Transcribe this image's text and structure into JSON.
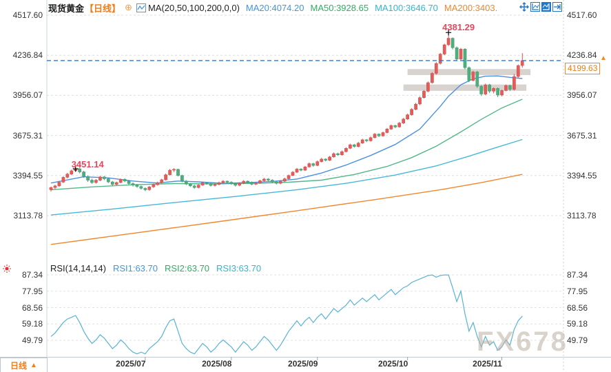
{
  "header": {
    "symbol": "现货黄金",
    "timeframe_tag": "【日线】",
    "add_icon": "⊕",
    "ma_label": "MA(20,50,100,200,0,0)",
    "ma_values": [
      {
        "label": "MA20:4074.20",
        "color": "#3f95e8"
      },
      {
        "label": "MA50:3928.65",
        "color": "#2fae62"
      },
      {
        "label": "MA100:3646.70",
        "color": "#2fb7d2"
      },
      {
        "label": "MA200:3403.",
        "color": "#f2862b"
      }
    ]
  },
  "toolbar": {
    "icons": [
      {
        "name": "pan-icon",
        "active": false
      },
      {
        "name": "left-axis-scale-icon",
        "active": false
      },
      {
        "name": "right-axis-scale-icon",
        "active": true
      },
      {
        "name": "shift-right-icon",
        "active": false
      }
    ],
    "accent_color": "#2176c7"
  },
  "rsi_header": {
    "name": "RSI(14,14,14)",
    "values": [
      {
        "label": "RSI1:63.70",
        "color": "#3f95e8"
      },
      {
        "label": "RSI2:63.70",
        "color": "#2fae62"
      },
      {
        "label": "RSI3:63.70",
        "color": "#2fb7d2"
      }
    ]
  },
  "footer": {
    "timeframe": "日线",
    "arrow": "▲"
  },
  "watermark": "FX678",
  "chart_data": [
    {
      "type": "candlestick",
      "title": "现货黄金 日线",
      "up_color": "#e15d5a",
      "down_color": "#4fae7d",
      "last_price": 4199.63,
      "last_price_line_color": "#1e78e8",
      "y_ticks": [
        4517.6,
        4236.84,
        3956.07,
        3675.31,
        3394.55,
        3113.78
      ],
      "x_labels": [
        {
          "label": "2025/07",
          "index": 23
        },
        {
          "label": "2025/08",
          "index": 44
        },
        {
          "label": "2025/09",
          "index": 65
        },
        {
          "label": "2025/10",
          "index": 87
        },
        {
          "label": "2025/11",
          "index": 110
        }
      ],
      "annotations": {
        "peak": {
          "index": 97,
          "price": 4381.29,
          "label": "4381.29"
        },
        "early_peak": {
          "index": 6,
          "price": 3451.14,
          "label": "3451.14"
        }
      },
      "zones": [
        {
          "i1": 87,
          "i2": 117,
          "p_top": 4140,
          "p_bottom": 4098
        },
        {
          "i1": 86,
          "i2": 116,
          "p_top": 4032,
          "p_bottom": 3988
        }
      ],
      "ma_series": [
        {
          "name": "MA200",
          "color": "#f2862b",
          "points": [
            [
              0,
              2912
            ],
            [
              20,
              2990
            ],
            [
              40,
              3068
            ],
            [
              60,
              3148
            ],
            [
              80,
              3230
            ],
            [
              95,
              3295
            ],
            [
              105,
              3345
            ],
            [
              115,
              3403
            ]
          ]
        },
        {
          "name": "MA100",
          "color": "#45b8d8",
          "points": [
            [
              0,
              3118
            ],
            [
              15,
              3160
            ],
            [
              30,
              3205
            ],
            [
              45,
              3248
            ],
            [
              60,
              3295
            ],
            [
              72,
              3340
            ],
            [
              84,
              3398
            ],
            [
              94,
              3462
            ],
            [
              102,
              3530
            ],
            [
              108,
              3585
            ],
            [
              115,
              3647
            ]
          ]
        },
        {
          "name": "MA50",
          "color": "#52b788",
          "points": [
            [
              0,
              3295
            ],
            [
              10,
              3315
            ],
            [
              20,
              3330
            ],
            [
              30,
              3338
            ],
            [
              40,
              3336
            ],
            [
              50,
              3340
            ],
            [
              58,
              3348
            ],
            [
              66,
              3362
            ],
            [
              74,
              3402
            ],
            [
              82,
              3458
            ],
            [
              88,
              3520
            ],
            [
              94,
              3600
            ],
            [
              100,
              3700
            ],
            [
              105,
              3788
            ],
            [
              110,
              3868
            ],
            [
              115,
              3929
            ]
          ]
        },
        {
          "name": "MA20",
          "color": "#4a90e2",
          "points": [
            [
              0,
              3342
            ],
            [
              8,
              3386
            ],
            [
              14,
              3378
            ],
            [
              20,
              3356
            ],
            [
              26,
              3342
            ],
            [
              31,
              3356
            ],
            [
              36,
              3350
            ],
            [
              42,
              3340
            ],
            [
              48,
              3345
            ],
            [
              54,
              3353
            ],
            [
              60,
              3370
            ],
            [
              66,
              3412
            ],
            [
              72,
              3468
            ],
            [
              78,
              3535
            ],
            [
              84,
              3612
            ],
            [
              90,
              3720
            ],
            [
              95,
              3880
            ],
            [
              97,
              3950
            ],
            [
              100,
              4030
            ],
            [
              103,
              4072
            ],
            [
              106,
              4090
            ],
            [
              109,
              4092
            ],
            [
              112,
              4082
            ],
            [
              115,
              4074
            ]
          ]
        }
      ],
      "candles": [
        [
          3295,
          3318,
          3282,
          3310
        ],
        [
          3310,
          3330,
          3300,
          3322
        ],
        [
          3322,
          3356,
          3315,
          3348
        ],
        [
          3348,
          3390,
          3342,
          3382
        ],
        [
          3382,
          3414,
          3375,
          3405
        ],
        [
          3405,
          3436,
          3398,
          3428
        ],
        [
          3428,
          3451.14,
          3420,
          3442
        ],
        [
          3442,
          3449,
          3410,
          3420
        ],
        [
          3420,
          3428,
          3378,
          3388
        ],
        [
          3388,
          3396,
          3350,
          3362
        ],
        [
          3362,
          3372,
          3336,
          3345
        ],
        [
          3345,
          3370,
          3338,
          3362
        ],
        [
          3362,
          3392,
          3355,
          3385
        ],
        [
          3385,
          3392,
          3362,
          3372
        ],
        [
          3372,
          3378,
          3342,
          3350
        ],
        [
          3350,
          3356,
          3322,
          3332
        ],
        [
          3332,
          3352,
          3325,
          3346
        ],
        [
          3346,
          3374,
          3340,
          3368
        ],
        [
          3368,
          3375,
          3348,
          3356
        ],
        [
          3356,
          3362,
          3330,
          3338
        ],
        [
          3338,
          3346,
          3318,
          3328
        ],
        [
          3328,
          3336,
          3308,
          3318
        ],
        [
          3318,
          3325,
          3296,
          3305
        ],
        [
          3305,
          3312,
          3285,
          3295
        ],
        [
          3295,
          3322,
          3288,
          3315
        ],
        [
          3315,
          3338,
          3308,
          3330
        ],
        [
          3330,
          3352,
          3324,
          3345
        ],
        [
          3345,
          3372,
          3338,
          3365
        ],
        [
          3365,
          3408,
          3360,
          3400
        ],
        [
          3400,
          3440,
          3394,
          3432
        ],
        [
          3432,
          3446,
          3420,
          3438
        ],
        [
          3438,
          3442,
          3388,
          3395
        ],
        [
          3395,
          3400,
          3348,
          3355
        ],
        [
          3355,
          3362,
          3328,
          3335
        ],
        [
          3335,
          3342,
          3315,
          3322
        ],
        [
          3322,
          3330,
          3302,
          3310
        ],
        [
          3310,
          3334,
          3304,
          3328
        ],
        [
          3328,
          3352,
          3322,
          3345
        ],
        [
          3345,
          3350,
          3330,
          3338
        ],
        [
          3338,
          3344,
          3318,
          3325
        ],
        [
          3325,
          3340,
          3318,
          3332
        ],
        [
          3332,
          3352,
          3326,
          3345
        ],
        [
          3345,
          3362,
          3338,
          3355
        ],
        [
          3355,
          3360,
          3340,
          3348
        ],
        [
          3348,
          3354,
          3330,
          3338
        ],
        [
          3338,
          3344,
          3318,
          3326
        ],
        [
          3326,
          3348,
          3320,
          3340
        ],
        [
          3340,
          3362,
          3334,
          3355
        ],
        [
          3355,
          3360,
          3340,
          3348
        ],
        [
          3348,
          3353,
          3326,
          3334
        ],
        [
          3334,
          3350,
          3328,
          3342
        ],
        [
          3342,
          3365,
          3336,
          3358
        ],
        [
          3358,
          3378,
          3352,
          3370
        ],
        [
          3370,
          3376,
          3354,
          3362
        ],
        [
          3362,
          3368,
          3342,
          3350
        ],
        [
          3350,
          3356,
          3332,
          3340
        ],
        [
          3340,
          3362,
          3334,
          3355
        ],
        [
          3355,
          3380,
          3350,
          3372
        ],
        [
          3372,
          3402,
          3366,
          3395
        ],
        [
          3395,
          3426,
          3390,
          3418
        ],
        [
          3418,
          3448,
          3412,
          3440
        ],
        [
          3440,
          3445,
          3424,
          3432
        ],
        [
          3432,
          3462,
          3426,
          3455
        ],
        [
          3455,
          3486,
          3450,
          3478
        ],
        [
          3478,
          3484,
          3456,
          3465
        ],
        [
          3465,
          3500,
          3460,
          3492
        ],
        [
          3492,
          3518,
          3486,
          3510
        ],
        [
          3510,
          3515,
          3494,
          3502
        ],
        [
          3502,
          3532,
          3496,
          3525
        ],
        [
          3525,
          3556,
          3520,
          3548
        ],
        [
          3548,
          3554,
          3532,
          3540
        ],
        [
          3540,
          3570,
          3534,
          3562
        ],
        [
          3562,
          3592,
          3556,
          3585
        ],
        [
          3585,
          3618,
          3580,
          3610
        ],
        [
          3610,
          3616,
          3590,
          3598
        ],
        [
          3598,
          3630,
          3592,
          3622
        ],
        [
          3622,
          3652,
          3616,
          3645
        ],
        [
          3645,
          3650,
          3628,
          3638
        ],
        [
          3638,
          3668,
          3632,
          3660
        ],
        [
          3660,
          3692,
          3654,
          3685
        ],
        [
          3685,
          3690,
          3664,
          3672
        ],
        [
          3672,
          3702,
          3666,
          3695
        ],
        [
          3695,
          3728,
          3690,
          3720
        ],
        [
          3720,
          3752,
          3714,
          3745
        ],
        [
          3745,
          3750,
          3726,
          3735
        ],
        [
          3735,
          3770,
          3730,
          3762
        ],
        [
          3762,
          3798,
          3756,
          3790
        ],
        [
          3790,
          3828,
          3784,
          3820
        ],
        [
          3820,
          3866,
          3814,
          3858
        ],
        [
          3858,
          3903,
          3852,
          3895
        ],
        [
          3895,
          3948,
          3888,
          3940
        ],
        [
          3940,
          3993,
          3934,
          3985
        ],
        [
          3985,
          4053,
          3978,
          4045
        ],
        [
          4045,
          4118,
          4038,
          4110
        ],
        [
          4110,
          4188,
          4102,
          4180
        ],
        [
          4180,
          4253,
          4172,
          4245
        ],
        [
          4245,
          4318,
          4238,
          4310
        ],
        [
          4310,
          4381.29,
          4302,
          4356
        ],
        [
          4356,
          4362,
          4278,
          4290
        ],
        [
          4290,
          4298,
          4196,
          4210
        ],
        [
          4210,
          4288,
          4204,
          4280
        ],
        [
          4280,
          4286,
          4138,
          4150
        ],
        [
          4150,
          4158,
          4048,
          4060
        ],
        [
          4060,
          4128,
          4054,
          4120
        ],
        [
          4120,
          4126,
          4008,
          4020
        ],
        [
          4020,
          4028,
          3952,
          3965
        ],
        [
          3965,
          4038,
          3958,
          4030
        ],
        [
          4030,
          4036,
          3972,
          3985
        ],
        [
          3985,
          4012,
          3970,
          4005
        ],
        [
          4005,
          4010,
          3944,
          3958
        ],
        [
          3958,
          3996,
          3950,
          3990
        ],
        [
          3990,
          4032,
          3984,
          4025
        ],
        [
          4025,
          4030,
          3986,
          3998
        ],
        [
          3998,
          4105,
          3990,
          4088
        ],
        [
          4088,
          4172,
          4080,
          4165
        ],
        [
          4165,
          4252,
          4150,
          4199.63
        ]
      ]
    },
    {
      "type": "line",
      "name": "RSI",
      "line_color": "#58b2d6",
      "y_ticks": [
        87.34,
        77.95,
        68.56,
        59.18,
        49.79
      ],
      "values": [
        52,
        54,
        57,
        60,
        62,
        63,
        64,
        60,
        55,
        51,
        48,
        50,
        53,
        51,
        48,
        45,
        47,
        50,
        48,
        45,
        43,
        42,
        43,
        42,
        45,
        47,
        49,
        52,
        57,
        61,
        62,
        55,
        48,
        45,
        43,
        42,
        45,
        48,
        46,
        43,
        45,
        48,
        50,
        48,
        46,
        43,
        46,
        49,
        47,
        44,
        46,
        49,
        52,
        50,
        47,
        44,
        47,
        51,
        55,
        58,
        61,
        58,
        61,
        63,
        60,
        63,
        65,
        62,
        65,
        68,
        66,
        68,
        70,
        73,
        70,
        72,
        74,
        72,
        74,
        76,
        73,
        75,
        77,
        79,
        76,
        78,
        80,
        81,
        83,
        84,
        85,
        86,
        87,
        87.3,
        86,
        87,
        87.3,
        87.3,
        80,
        72,
        78,
        65,
        55,
        60,
        52,
        46,
        52,
        47,
        49,
        44,
        46,
        50,
        47,
        56,
        61,
        63.7
      ]
    }
  ]
}
